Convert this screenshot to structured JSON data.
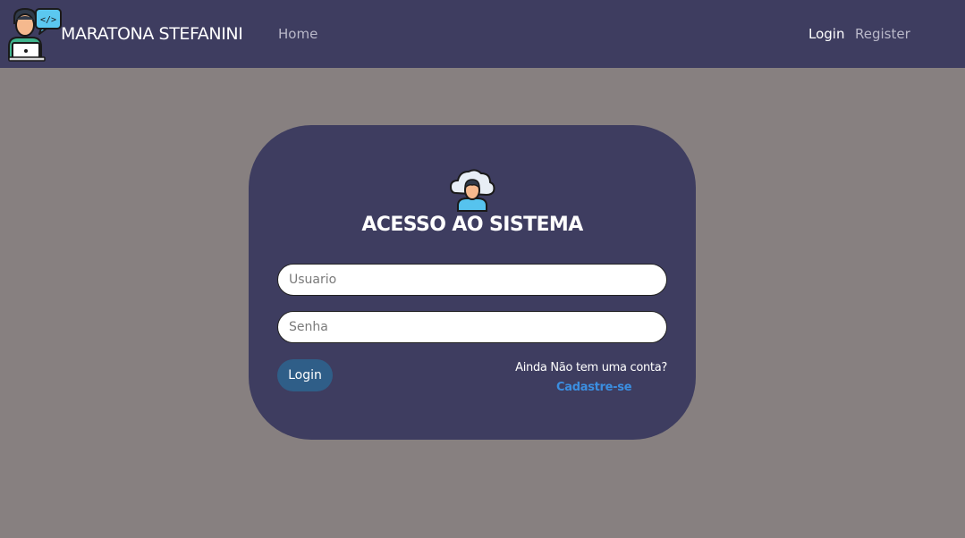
{
  "navbar": {
    "brand": "MARATONA STEFANINI",
    "links": [
      {
        "label": "Home"
      },
      {
        "label": "Login"
      },
      {
        "label": "Register"
      }
    ],
    "logo_icon": "developer-laptop-icon"
  },
  "login_card": {
    "icon": "cloud-user-avatar-icon",
    "title": "ACESSO AO SISTEMA",
    "username_placeholder": "Usuario",
    "password_placeholder": "Senha",
    "login_button": "Login",
    "signup_prompt": "Ainda Não tem uma conta?",
    "signup_link": "Cadastre-se"
  },
  "colors": {
    "background": "#878080",
    "navbar": "#3e3d60",
    "card": "#3e3d60",
    "button": "#2f5e88",
    "link": "#3b8ee0"
  }
}
